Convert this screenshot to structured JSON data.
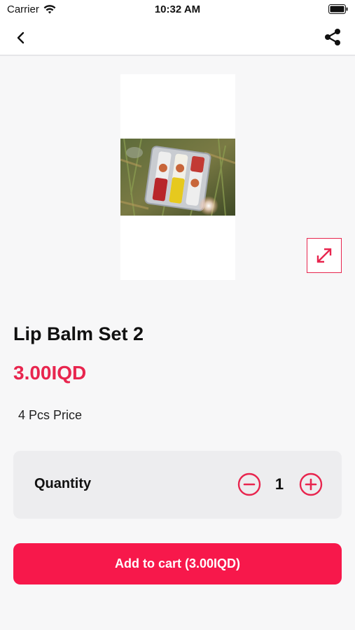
{
  "status_bar": {
    "carrier": "Carrier",
    "time": "10:32 AM",
    "icons": [
      "wifi-icon",
      "battery-icon"
    ]
  },
  "nav": {
    "back_icon": "chevron-left-icon",
    "share_icon": "share-icon"
  },
  "product": {
    "image_alt_icon": "product-photo",
    "expand_icon": "expand-arrows-icon",
    "title": "Lip Balm Set 2",
    "price": "3.00IQD",
    "description": "4 Pcs Price"
  },
  "quantity": {
    "label": "Quantity",
    "value": "1",
    "minus_icon": "minus-circle-icon",
    "plus_icon": "plus-circle-icon"
  },
  "cart": {
    "button_label": "Add to cart (3.00IQD)"
  },
  "colors": {
    "accent": "#f7184b",
    "price": "#e8254e",
    "background": "#f7f7f8"
  }
}
